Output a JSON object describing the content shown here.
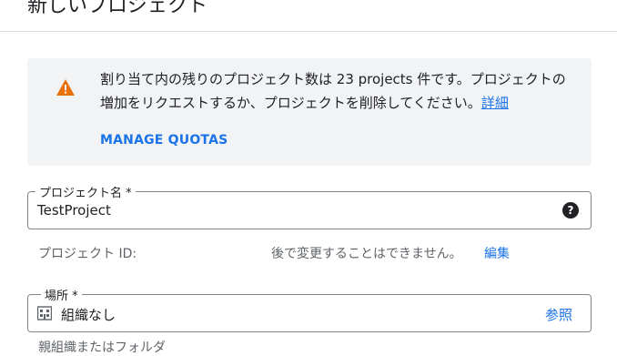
{
  "page": {
    "title": "新しいプロジェクト"
  },
  "notice": {
    "text": "割り当て内の残りのプロジェクト数は 23 projects 件です。プロジェクトの増加をリクエストするか、プロジェクトを削除してください。",
    "learn_more": "詳細",
    "manage_quotas": "MANAGE QUOTAS",
    "icon": "warning-icon",
    "icon_color": "#e8710a"
  },
  "project_name": {
    "label": "プロジェクト名 *",
    "value": "TestProject",
    "help_icon": "help-icon"
  },
  "project_id": {
    "label": "プロジェクト ID:",
    "note": "後で変更することはできません。",
    "edit": "編集"
  },
  "location": {
    "label": "場所 *",
    "value": "組織なし",
    "browse": "参照",
    "icon": "organization-icon",
    "hint": "親組織またはフォルダ"
  },
  "colors": {
    "accent": "#1a73e8",
    "notice_bg": "#f1f3f4"
  }
}
